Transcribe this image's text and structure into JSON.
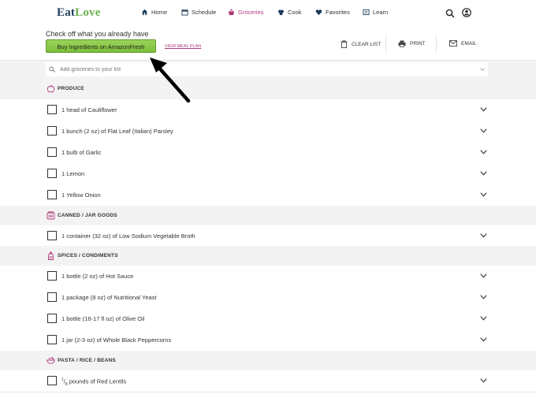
{
  "brand": {
    "logo_left": "Eat",
    "logo_right": "Love",
    "leaf_color": "#6ab04c",
    "accent": "#b03a7a"
  },
  "nav": {
    "home": "Home",
    "schedule": "Schedule",
    "groceries": "Groceries",
    "cook": "Cook",
    "favorites": "Favorites",
    "learn": "Learn"
  },
  "toolbar": {
    "heading": "Check off what you already have",
    "amazon_button": "Buy Ingredients on AmazonFresh",
    "view_meal_plan": "VIEW MEAL PLAN",
    "clear_list": "CLEAR LIST",
    "print": "PRINT",
    "email": "EMAIL"
  },
  "search": {
    "placeholder": "Add groceries to your list"
  },
  "categories": {
    "produce": "PRODUCE",
    "canned": "CANNED / JAR GOODS",
    "spices": "SPICES / CONDIMENTS",
    "pasta": "PASTA / RICE / BEANS"
  },
  "items": {
    "cauliflower": "1 head of Cauliflower",
    "parsley": "1 bunch (2 oz) of Flat Leaf (Italian) Parsley",
    "garlic": "1 bulb of Garlic",
    "lemon": "1 Lemon",
    "onion": "1 Yellow Onion",
    "broth": "1 container (32 oz) of Low Sodium Vegetable Broth",
    "hot_sauce": "1 bottle (2 oz) of Hot Sauce",
    "yeast": "1 package (8 oz) of Nutritional Yeast",
    "olive_oil": "1 bottle (16-17 fl oz) of Olive Oil",
    "peppercorns": "1 jar (2-3 oz) of Whole Black Peppercorns",
    "lentils_num": "1",
    "lentils_den": "8",
    "lentils_rest": "pounds of Red Lentils"
  }
}
